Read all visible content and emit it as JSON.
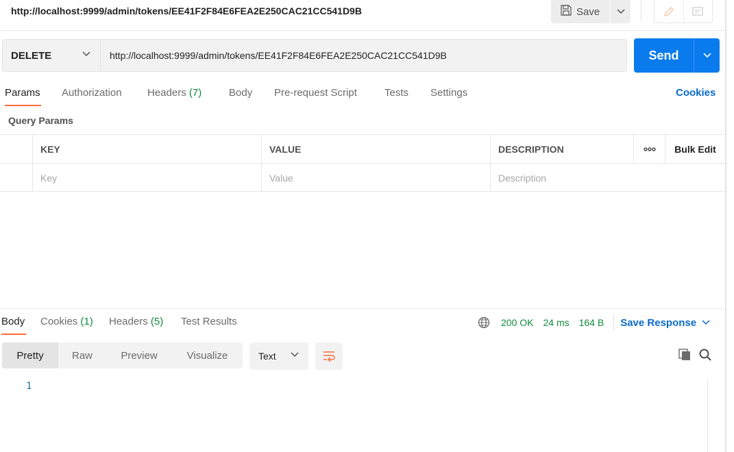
{
  "window": {
    "title": "http://localhost:9999/admin/tokens/EE41F2F84E6FEA2E250CAC21CC541D9B",
    "save_label": "Save"
  },
  "request": {
    "method": "DELETE",
    "url": "http://localhost:9999/admin/tokens/EE41F2F84E6FEA2E250CAC21CC541D9B",
    "send_label": "Send",
    "tabs": [
      {
        "label": "Params",
        "count": ""
      },
      {
        "label": "Authorization",
        "count": ""
      },
      {
        "label": "Headers",
        "count": "(7)"
      },
      {
        "label": "Body",
        "count": ""
      },
      {
        "label": "Pre-request Script",
        "count": ""
      },
      {
        "label": "Tests",
        "count": ""
      },
      {
        "label": "Settings",
        "count": ""
      }
    ],
    "active_tab": "Params",
    "cookies_label": "Cookies"
  },
  "query_params": {
    "section_label": "Query Params",
    "columns": {
      "key": "KEY",
      "value": "VALUE",
      "description": "DESCRIPTION",
      "more": "ooo",
      "bulk_edit": "Bulk Edit"
    },
    "placeholders": {
      "key": "Key",
      "value": "Value",
      "description": "Description"
    }
  },
  "response": {
    "tabs": [
      {
        "label": "Body",
        "count": ""
      },
      {
        "label": "Cookies",
        "count": "(1)"
      },
      {
        "label": "Headers",
        "count": "(5)"
      },
      {
        "label": "Test Results",
        "count": ""
      }
    ],
    "active_tab": "Body",
    "status": "200 OK",
    "time": "24 ms",
    "size": "164 B",
    "save_response_label": "Save Response",
    "formats": [
      "Pretty",
      "Raw",
      "Preview",
      "Visualize"
    ],
    "active_format": "Pretty",
    "text_type": "Text",
    "line_number": "1"
  },
  "colors": {
    "accent": "#ff6c37",
    "send": "#097bed",
    "status_ok": "#0f8a3c",
    "link": "#0b6bcb"
  }
}
